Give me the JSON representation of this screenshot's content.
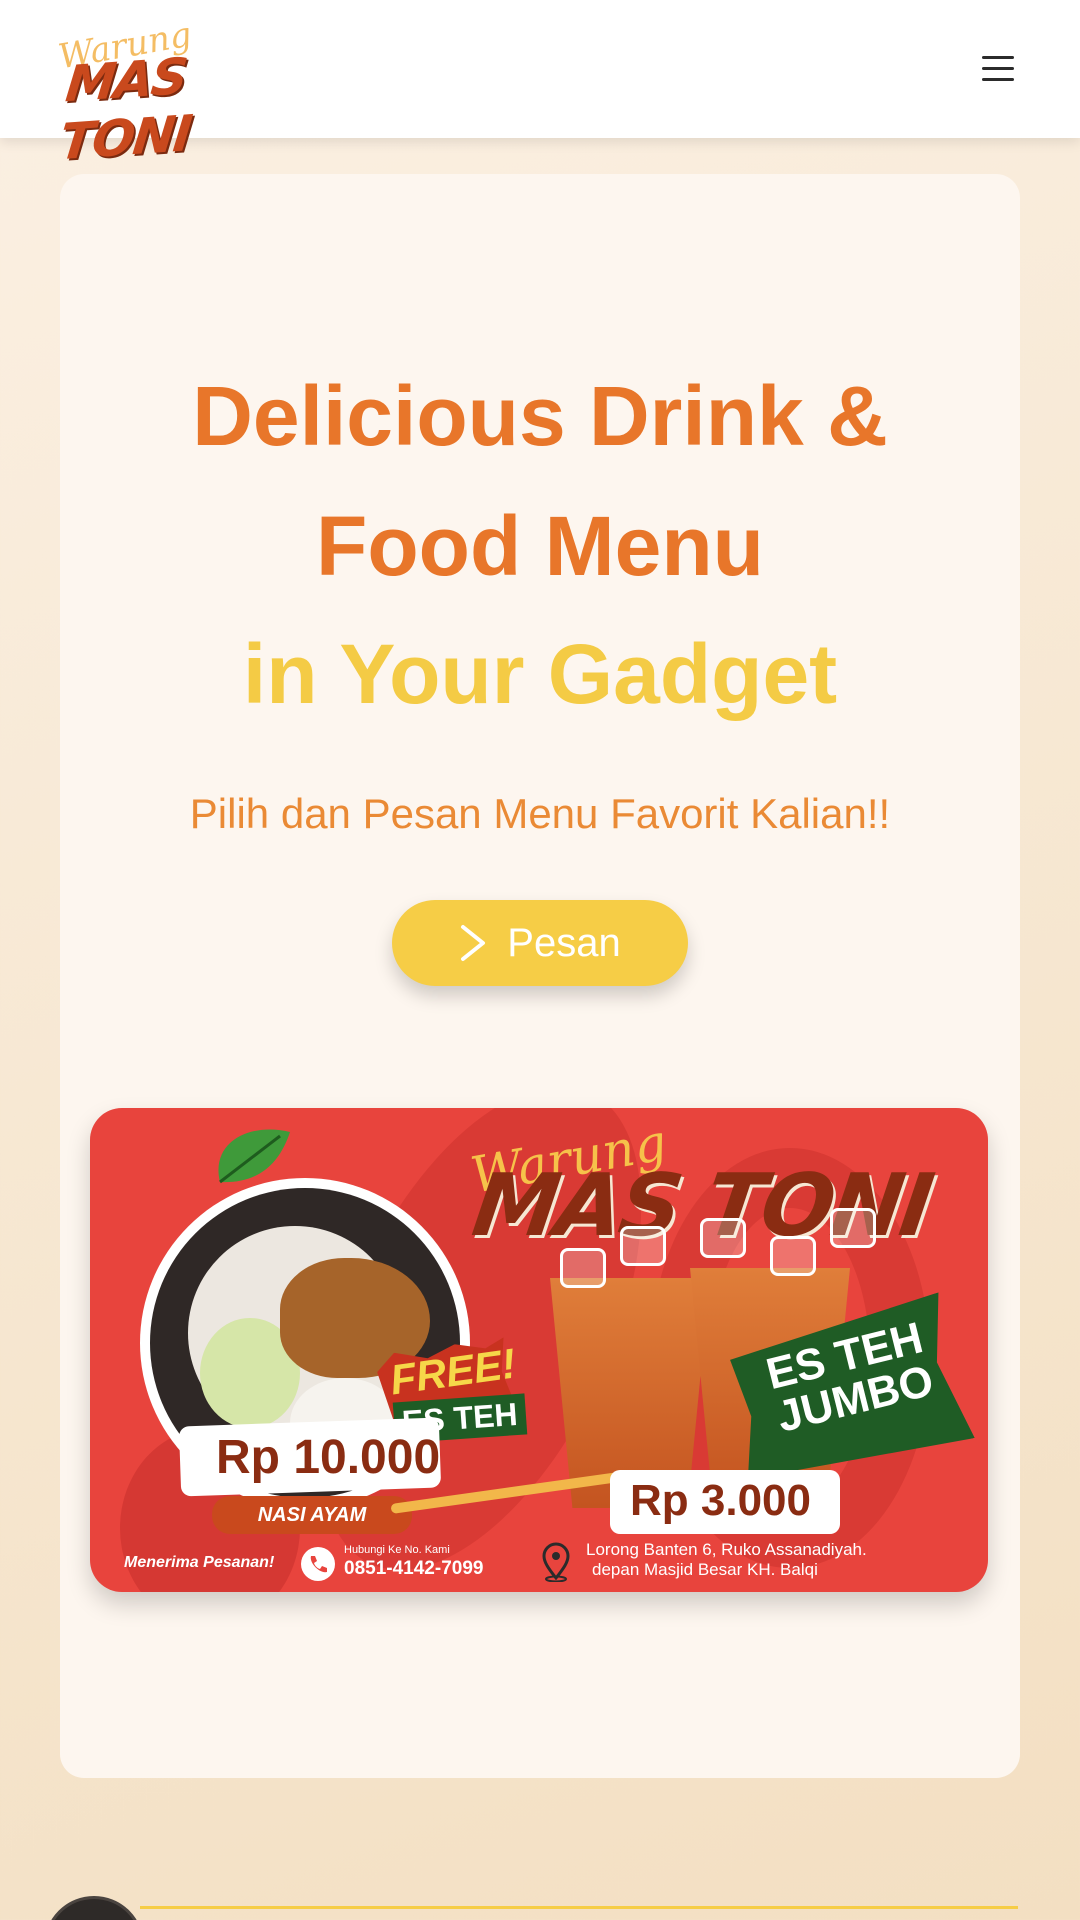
{
  "header": {
    "logo_script": "Warung",
    "logo_main": "MAS TONI",
    "menu_icon": "hamburger-menu-icon"
  },
  "hero": {
    "title_line1": "Delicious Drink &",
    "title_line2": "Food Menu",
    "title_line3": "in Your Gadget",
    "subtitle": "Pilih dan Pesan Menu Favorit Kalian!!",
    "button_label": "Pesan",
    "button_icon": "chevron-right-icon"
  },
  "banner": {
    "script": "Warung",
    "title": "MAS TONI",
    "free_label": "FREE!",
    "free_item": "ES TEH",
    "price_left": "Rp 10.000",
    "item_left": "NASI AYAM",
    "jumbo_label": "ES TEH JUMBO",
    "price_right": "Rp 3.000",
    "order_label": "Menerima Pesanan!",
    "phone_caption": "Hubungi Ke No. Kami",
    "phone_number": "0851-4142-7099",
    "address_line1": "Lorong Banten 6, Ruko Assanadiyah.",
    "address_line2": "depan Masjid Besar KH. Balqi"
  },
  "colors": {
    "accent_orange": "#e8762a",
    "accent_yellow": "#f4cb45",
    "banner_red": "#e8443d",
    "brand_brown": "#8a2c12"
  }
}
